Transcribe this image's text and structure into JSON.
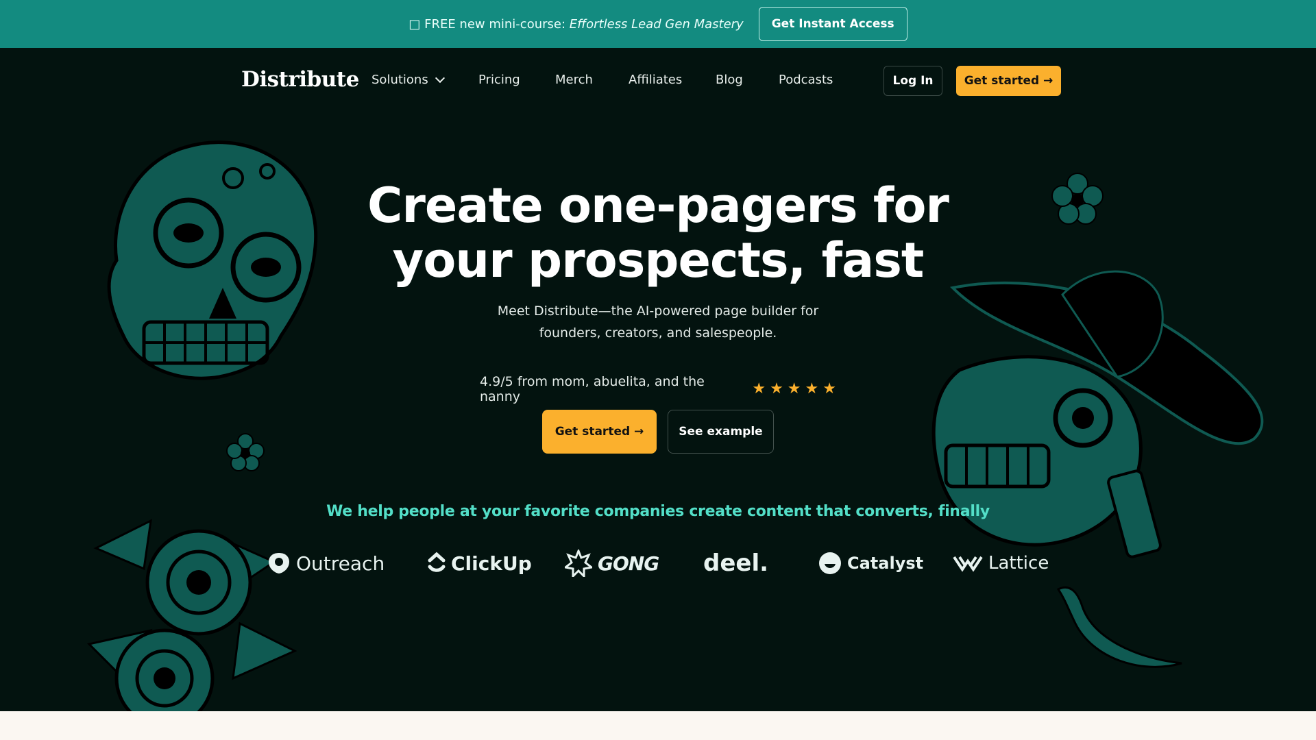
{
  "announcement": {
    "prefix": "□ FREE new mini-course: ",
    "course": "Effortless Lead Gen Mastery",
    "cta": "Get Instant Access"
  },
  "nav": {
    "logo": "Distribute",
    "links": [
      "Solutions",
      "Pricing",
      "Merch",
      "Affiliates",
      "Blog",
      "Podcasts"
    ],
    "login": "Log In",
    "get_started": "Get started →"
  },
  "hero": {
    "headline_line1": "Create one-pagers for",
    "headline_line2": "your prospects, fast",
    "subtitle_line1": "Meet Distribute—the AI-powered page builder for",
    "subtitle_line2": "founders, creators, and salespeople.",
    "rating_text": "4.9/5 from mom, abuelita, and the nanny",
    "stars": 5,
    "primary_cta": "Get started →",
    "secondary_cta": "See example"
  },
  "social_proof": {
    "tagline": "We help people at your favorite companies create content that converts, finally",
    "companies": [
      "Outreach",
      "ClickUp",
      "GONG",
      "deel.",
      "Catalyst",
      "Lattice"
    ]
  },
  "colors": {
    "banner": "#138b80",
    "background": "#03130f",
    "accent": "#fbb02d",
    "tagline": "#53dfc8",
    "decor": "#0f5a52"
  }
}
